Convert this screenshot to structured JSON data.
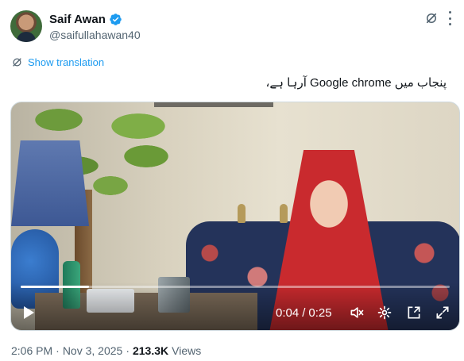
{
  "author": {
    "display_name": "Saif Awan",
    "handle": "@saifullahawan40",
    "verified": true,
    "avatar_icon": "avatar"
  },
  "header_icons": [
    "grok-icon",
    "more-icon"
  ],
  "translate": {
    "label": "Show translation",
    "icon": "translate-icon"
  },
  "tweet": {
    "text": "پنجاب میں Google chrome آرہا ہے،"
  },
  "video": {
    "current_time": "0:04",
    "duration": "0:25",
    "separator": "/",
    "progress_fraction": 0.16,
    "controls": [
      "play-icon",
      "mute-icon",
      "settings-icon",
      "popout-icon",
      "fullscreen-icon"
    ]
  },
  "meta": {
    "time": "2:06 PM",
    "dot": "·",
    "date": "Nov 3, 2025",
    "views_count": "213.3K",
    "views_label": "Views"
  },
  "colors": {
    "accent": "#1d9bf0",
    "text": "#0f1419",
    "muted": "#536471"
  }
}
